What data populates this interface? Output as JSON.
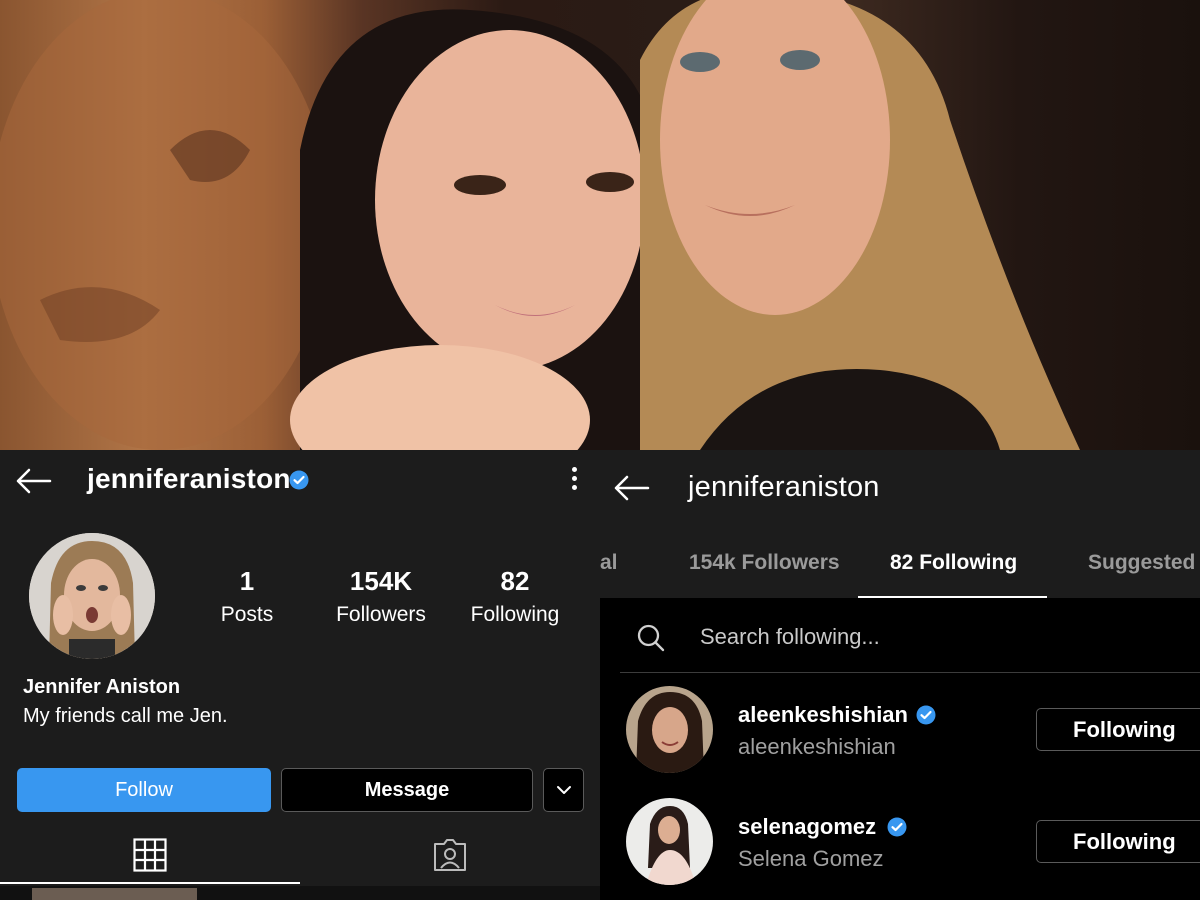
{
  "photo": {
    "description_icon": "photo-banner"
  },
  "left_profile": {
    "username": "jenniferaniston",
    "verified": true,
    "stats": [
      {
        "value": "1",
        "label": "Posts"
      },
      {
        "value": "154K",
        "label": "Followers"
      },
      {
        "value": "82",
        "label": "Following"
      }
    ],
    "full_name": "Jennifer Aniston",
    "bio": "My friends call me Jen.",
    "follow_label": "Follow",
    "message_label": "Message",
    "icons": {
      "back": "arrow-left-icon",
      "menu": "kebab-menu-icon",
      "dropdown": "chevron-down-icon",
      "grid": "grid-icon",
      "tagged": "tagged-icon"
    }
  },
  "right_following": {
    "username": "jenniferaniston",
    "tabs": [
      {
        "label": "al"
      },
      {
        "label": "154k Followers"
      },
      {
        "label": "82 Following",
        "active": true
      },
      {
        "label": "Suggested"
      }
    ],
    "search_placeholder": "Search following...",
    "rows": [
      {
        "username": "aleenkeshishian",
        "subtitle": "aleenkeshishian",
        "verified": true,
        "button": "Following"
      },
      {
        "username": "selenagomez",
        "subtitle": "Selena Gomez",
        "verified": true,
        "button": "Following"
      }
    ]
  },
  "colors": {
    "accent_blue": "#3897f0",
    "panel_bg": "#1c1c1c",
    "list_bg": "#000000"
  }
}
